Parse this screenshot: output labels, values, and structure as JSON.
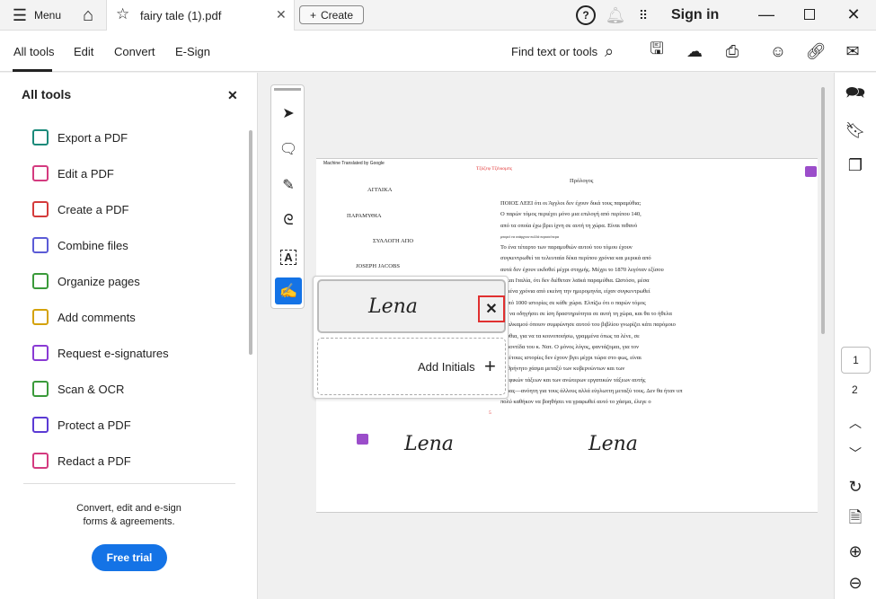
{
  "titlebar": {
    "menu_label": "Menu",
    "tab_title": "fairy tale (1).pdf",
    "create_label": "Create",
    "sign_in": "Sign in"
  },
  "toolbar": {
    "tabs": [
      "All tools",
      "Edit",
      "Convert",
      "E-Sign"
    ],
    "active_tab": "All tools",
    "search_label": "Find text or tools"
  },
  "sidebar": {
    "title": "All tools",
    "items": [
      {
        "label": "Export a PDF",
        "color": "#1a8a7a"
      },
      {
        "label": "Edit a PDF",
        "color": "#d43a7f"
      },
      {
        "label": "Create a PDF",
        "color": "#d43a3a"
      },
      {
        "label": "Combine files",
        "color": "#5b5bd6"
      },
      {
        "label": "Organize pages",
        "color": "#3a9a3a"
      },
      {
        "label": "Add comments",
        "color": "#d4a20a"
      },
      {
        "label": "Request e-signatures",
        "color": "#8a3ad4"
      },
      {
        "label": "Scan & OCR",
        "color": "#3a9a3a"
      },
      {
        "label": "Protect a PDF",
        "color": "#5b3ad4"
      },
      {
        "label": "Redact a PDF",
        "color": "#d43a7f"
      }
    ],
    "promo_text_1": "Convert, edit and e-sign",
    "promo_text_2": "forms & agreements.",
    "free_trial": "Free trial"
  },
  "document": {
    "machine_translated": "Machine Translated by Google",
    "red_header": "Τζόζεφ Τζέικομπς",
    "preface": "Πρόλογος",
    "left_titles": [
      "ΑΓΓΛΙΚΑ",
      "ΠΑΡΑΜΥΘΙΑ",
      "ΣΥΛΛΟΓΗ ΑΠΟ",
      "JOSEPH JACOBS"
    ],
    "lines": [
      "ΠΟΙΟΣ ΛΕΕΙ ότι οι Άγγλοι δεν έχουν δικά τους παραμύθια;",
      "Ο παρών τόμος περιέχει μόνο μια επιλογή από περίπου 140,",
      " από τα οποία έχω βρει ίχνη σε αυτή τη χώρα. Είναι πιθανό",
      "μπορεί να υπάρχουν πολλά περισσότερα",
      "  Το ένα τέταρτο των παραμυθιών αυτού του τόμου έχουν",
      "συγκεντρωθεί τα τελευταία δέκα περίπου χρόνια και μερικά από",
      "αυτά δεν έχουν εκδοθεί μέχρι στιγμής. Μέχρι το 1870 λεγόταν εξίσου",
      "ία και Ιταλία, ότι δεν διέθεταν λαϊκά παραμύθια. Ωστόσο, μέσα",
      "ασμένα χρόνια από εκείνη την ημερομηνία, είχαν συγκεντρωθεί",
      "α από 1000 ιστορίες σε κάθε χώρα. Ελπίζω ότι ο παρών τόμος",
      "ραί να οδηγήσει σε ίση δραστηριότητα σε αυτή τη χώρα, και θα το ήθελα",
      "ίω αλκαμού όποιον συμφώνησε αυτού του βιβλίου γνωρίζει κάτι παρόμοιο",
      "αμύθια, για να τα κοινοποιήσω, γραμμένα όπως τα λένε, σε",
      ", φροντίδα του κ. Νατ. Ο μόνος λόγος, φαντάζομαι, για τον",
      "ιο τέτοιες ιστορίες δεν έχουν βγει μέχρι τώρα στο φως, είναι",
      "ξιοθρήνητο χάσμα μεταξύ των κυβερνώντων και των",
      "γραφικών τάξεων και των ανώτερων εργατικών τάξεων αυτής",
      "χώρας—ανόητη για τους άλλους αλλά εύγλωττη μεταξύ τους. Δεν θα ήταν υπ",
      "πολύ καθήκον να βοηθήσει να γραφωθεί αυτό το χάσμα, έλεγε ο"
    ],
    "page_mark": "5",
    "signature": "Lena"
  },
  "signature_panel": {
    "signature": "Lena",
    "add_initials": "Add Initials"
  },
  "pages": {
    "current": "1",
    "next": "2"
  },
  "colors": {
    "accent": "#1473e6",
    "comment": "#9b4dca",
    "highlight_box": "#e03030"
  }
}
